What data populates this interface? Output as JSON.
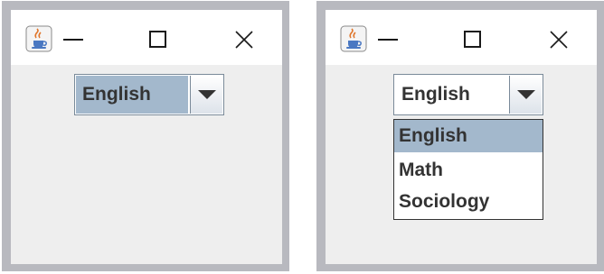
{
  "left_window": {
    "combo": {
      "selected_value": "English"
    }
  },
  "right_window": {
    "combo": {
      "selected_value": "English"
    },
    "dropdown": {
      "options": [
        "English",
        "Math",
        "Sociology"
      ],
      "highlighted_index": 0
    }
  },
  "icons": {
    "app": "java-coffee-cup-icon",
    "minimize": "minimize-icon",
    "maximize": "maximize-icon",
    "close": "close-icon",
    "dropdown": "dropdown-arrow-icon"
  },
  "colors": {
    "selection": "#a3b8cc",
    "titlebar": "#ffffff",
    "content": "#eeeeee",
    "frame": "#b8b9bf"
  }
}
